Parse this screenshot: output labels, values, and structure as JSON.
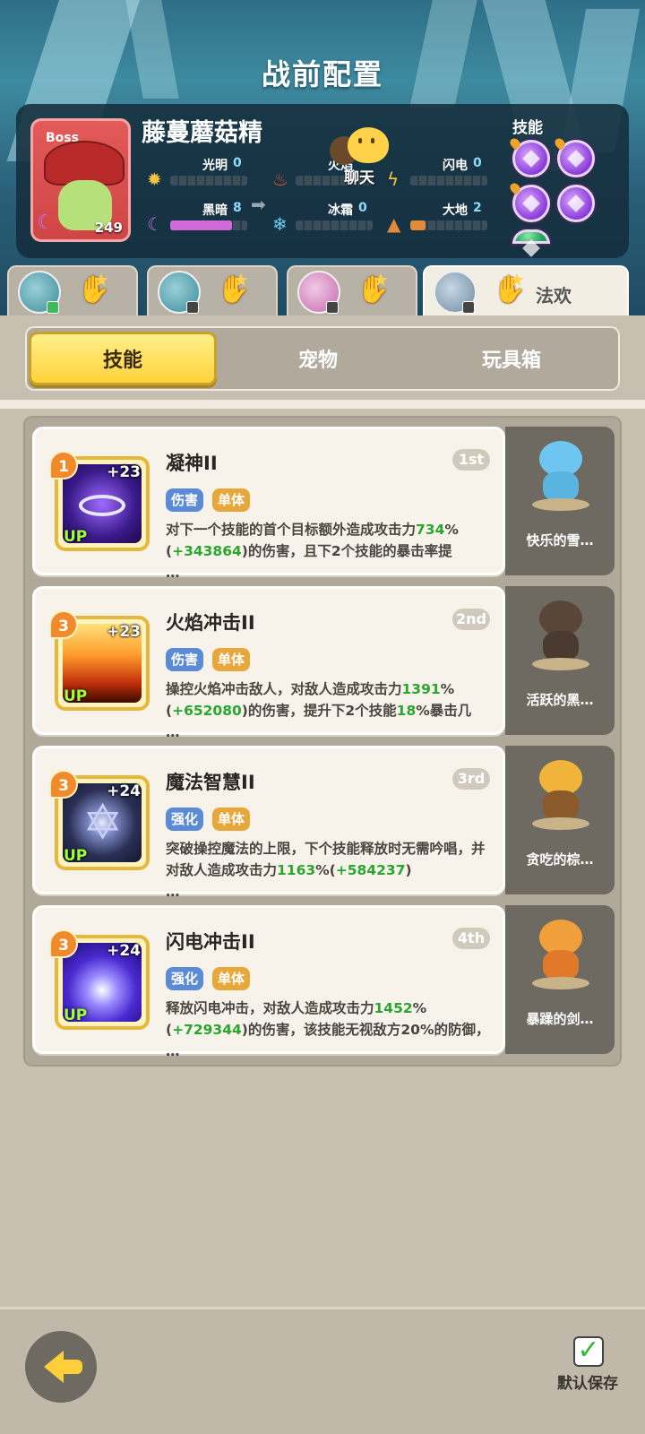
{
  "header": {
    "title": "战前配置"
  },
  "boss": {
    "tag": "Boss",
    "name": "藤蔓蘑菇精",
    "level": "249",
    "attributes": [
      {
        "name": "光明",
        "value": "0",
        "level_fraction": 0.0,
        "color": "#f5c542"
      },
      {
        "name": "火焰",
        "value": "",
        "level_fraction": 0.0,
        "color": "#e2533a"
      },
      {
        "name": "闪电",
        "value": "0",
        "level_fraction": 0.0,
        "color": "#f5c542"
      },
      {
        "name": "黑暗",
        "value": "8",
        "level_fraction": 0.8,
        "color": "#d06ad8"
      },
      {
        "name": "冰霜",
        "value": "0",
        "level_fraction": 0.0,
        "color": "#6ad0f0"
      },
      {
        "name": "大地",
        "value": "2",
        "level_fraction": 0.2,
        "color": "#e08a3a"
      }
    ],
    "skills_label": "技能"
  },
  "chat": {
    "label": "聊天"
  },
  "team_tabs": [
    {
      "name": "",
      "active": false
    },
    {
      "name": "",
      "active": false
    },
    {
      "name": "",
      "active": false
    },
    {
      "name": "法欢",
      "active": true
    }
  ],
  "sub_tabs": {
    "skills": "技能",
    "pets": "宠物",
    "toybox": "玩具箱",
    "active": "skills"
  },
  "skill_cards": [
    {
      "title": "凝神II",
      "order": "1st",
      "badge": "1",
      "plus": "+23",
      "up": "UP",
      "tags": [
        "伤害",
        "单体"
      ],
      "desc_a": "对下一个技能的首个目标额外造成攻击力",
      "num1": "734",
      "desc_b": "%(",
      "num2": "+343864",
      "desc_c": ")的伤害，且下2个技能的暴击率提",
      "ellipsis": "…",
      "pet_name": "快乐的雪…"
    },
    {
      "title": "火焰冲击II",
      "order": "2nd",
      "badge": "3",
      "plus": "+23",
      "up": "UP",
      "tags": [
        "伤害",
        "单体"
      ],
      "desc_a": "操控火焰冲击敌人，对敌人造成攻击力",
      "num1": "1391",
      "desc_b": "%(",
      "num2": "+652080",
      "desc_c": ")的伤害，提升下2个技能",
      "num3": "18",
      "desc_d": "%暴击几",
      "ellipsis": "…",
      "pet_name": "活跃的黑…"
    },
    {
      "title": "魔法智慧II",
      "order": "3rd",
      "badge": "3",
      "plus": "+24",
      "up": "UP",
      "tags": [
        "强化",
        "单体"
      ],
      "desc_a": "突破操控魔法的上限，下个技能释放时无需吟唱，并对敌人造成攻击力",
      "num1": "1163",
      "desc_b": "%(",
      "num2": "+584237",
      "desc_c": ")",
      "ellipsis": "…",
      "pet_name": "贪吃的棕…"
    },
    {
      "title": "闪电冲击II",
      "order": "4th",
      "badge": "3",
      "plus": "+24",
      "up": "UP",
      "tags": [
        "强化",
        "单体"
      ],
      "desc_a": "释放闪电冲击，对敌人造成攻击力",
      "num1": "1452",
      "desc_b": "%(",
      "num2": "+729344",
      "desc_c": ")的伤害，该技能无视敌方20%的防御，",
      "ellipsis": "…",
      "pet_name": "暴躁的剑…"
    }
  ],
  "footer": {
    "save_label": "默认保存"
  }
}
